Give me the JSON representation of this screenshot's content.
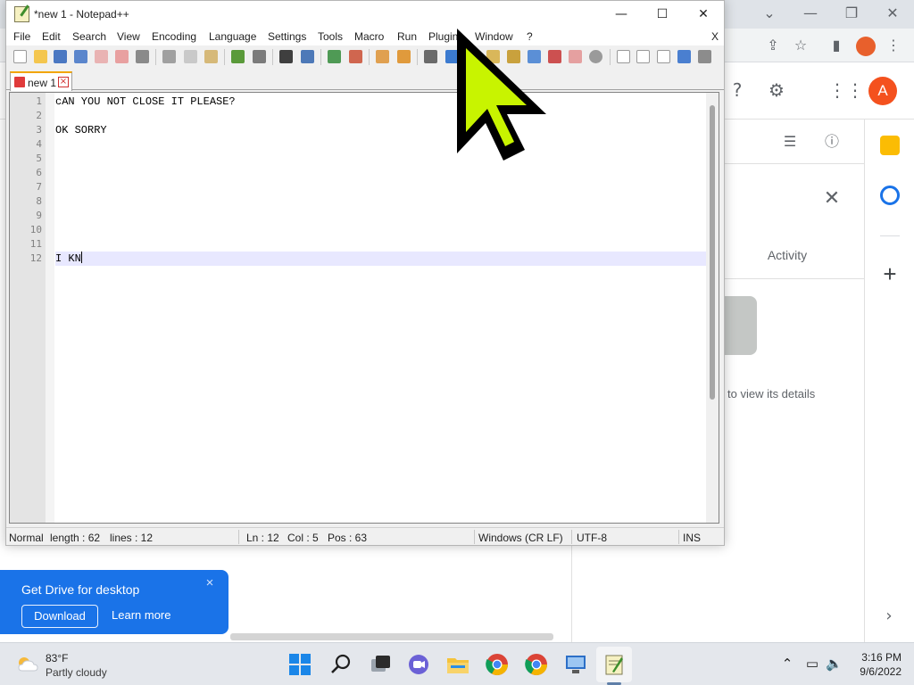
{
  "notepad": {
    "title": "*new 1 - Notepad++",
    "window_controls": {
      "minimize": "—",
      "maximize": "☐",
      "close": "✕"
    },
    "menu": [
      "File",
      "Edit",
      "Search",
      "View",
      "Encoding",
      "Language",
      "Settings",
      "Tools",
      "Macro",
      "Run",
      "Plugins",
      "Window",
      "?"
    ],
    "menu_close": "X",
    "tab": {
      "label": "new 1",
      "close_glyph": "×"
    },
    "lines": [
      {
        "num": "1",
        "text": "cAN YOU NOT CLOSE IT PLEASE?"
      },
      {
        "num": "2",
        "text": ""
      },
      {
        "num": "3",
        "text": "OK SORRY"
      },
      {
        "num": "4",
        "text": ""
      },
      {
        "num": "5",
        "text": ""
      },
      {
        "num": "6",
        "text": ""
      },
      {
        "num": "7",
        "text": ""
      },
      {
        "num": "8",
        "text": ""
      },
      {
        "num": "9",
        "text": ""
      },
      {
        "num": "10",
        "text": ""
      },
      {
        "num": "11",
        "text": ""
      },
      {
        "num": "12",
        "text": "I KN"
      }
    ],
    "current_line": 12,
    "status": {
      "mode": "Normal",
      "length": "length : 62",
      "lines": "lines : 12",
      "ln": "Ln : 12",
      "col": "Col : 5",
      "pos": "Pos : 63",
      "eol": "Windows (CR LF)",
      "encoding": "UTF-8",
      "ins": "INS"
    }
  },
  "drive": {
    "details_tab": "Activity",
    "details_hint": "to view its details",
    "avatar_letter": "A",
    "promo": {
      "title": "Get Drive for desktop",
      "download": "Download",
      "learn_more": "Learn more",
      "close": "×"
    }
  },
  "taskbar": {
    "weather_temp": "83°F",
    "weather_desc": "Partly cloudy",
    "time": "3:16 PM",
    "date": "9/6/2022"
  },
  "colors": {
    "cursor": "#c8f400",
    "promo_bg": "#1a73e8",
    "tab_accent": "#f2a500",
    "current_line_bg": "#e8e8ff"
  }
}
